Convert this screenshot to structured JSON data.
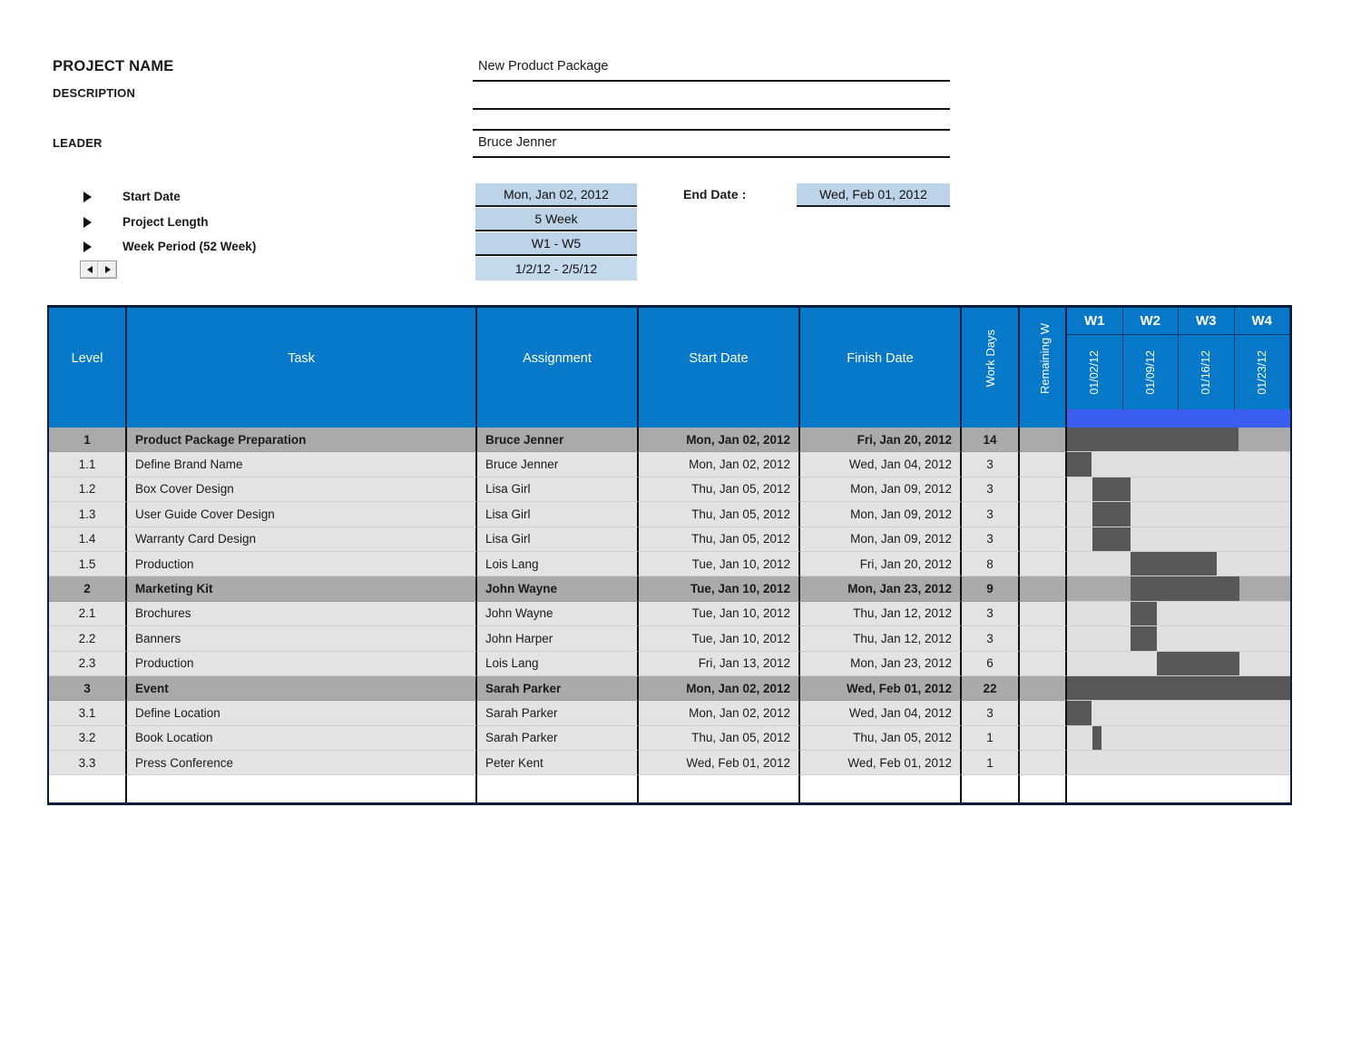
{
  "header": {
    "project_name_label": "PROJECT NAME",
    "description_label": "DESCRIPTION",
    "leader_label": "LEADER",
    "project_name_value": "New Product Package",
    "description_value": "",
    "leader_value": "Bruce Jenner",
    "start_date_label": "Start Date",
    "project_length_label": "Project Length",
    "week_period_label": "Week Period (52 Week)",
    "start_date_value": "Mon, Jan 02, 2012",
    "project_length_value": "5 Week",
    "week_period_value": "W1 - W5",
    "date_range_value": "1/2/12 - 2/5/12",
    "end_date_label": "End Date :",
    "end_date_value": "Wed, Feb 01, 2012",
    "scroll_left": "◀",
    "scroll_right": "▶"
  },
  "colors": {
    "header_blue": "#0878c8",
    "accent_blue": "#3a5ff0",
    "bar_dark": "#585858",
    "group_gray": "#aaaaaa",
    "row_gray": "#e3e3e3",
    "input_blue": "#bcd3e8"
  },
  "table": {
    "columns": [
      {
        "key": "level",
        "label": "Level"
      },
      {
        "key": "task",
        "label": "Task"
      },
      {
        "key": "assg",
        "label": "Assignment"
      },
      {
        "key": "start",
        "label": "Start Date"
      },
      {
        "key": "finish",
        "label": "Finish Date"
      },
      {
        "key": "wd",
        "label": "Work Days"
      },
      {
        "key": "rw",
        "label": "Remaining W"
      }
    ],
    "weeks": [
      {
        "label": "W1",
        "date": "01/02/12"
      },
      {
        "label": "W2",
        "date": "01/09/12"
      },
      {
        "label": "W3",
        "date": "01/16/12"
      },
      {
        "label": "W4",
        "date": "01/23/12"
      }
    ],
    "rows": [
      {
        "level": "1",
        "task": "Product Package Preparation",
        "assignment": "Bruce Jenner",
        "start": "Mon, Jan 02, 2012",
        "finish": "Fri, Jan 20, 2012",
        "work_days": "14",
        "remaining_weeks": "",
        "group": true,
        "bar_left_pct": 0.0,
        "bar_width_pct": 77.0
      },
      {
        "level": "1.1",
        "task": "Define Brand Name",
        "assignment": "Bruce Jenner",
        "start": "Mon, Jan 02, 2012",
        "finish": "Wed, Jan 04, 2012",
        "work_days": "3",
        "remaining_weeks": "",
        "group": false,
        "bar_left_pct": 0.0,
        "bar_width_pct": 11.0
      },
      {
        "level": "1.2",
        "task": "Box Cover Design",
        "assignment": "Lisa Girl",
        "start": "Thu, Jan 05, 2012",
        "finish": "Mon, Jan 09, 2012",
        "work_days": "3",
        "remaining_weeks": "",
        "group": false,
        "bar_left_pct": 11.4,
        "bar_width_pct": 17.0
      },
      {
        "level": "1.3",
        "task": "User Guide Cover Design",
        "assignment": "Lisa Girl",
        "start": "Thu, Jan 05, 2012",
        "finish": "Mon, Jan 09, 2012",
        "work_days": "3",
        "remaining_weeks": "",
        "group": false,
        "bar_left_pct": 11.4,
        "bar_width_pct": 17.0
      },
      {
        "level": "1.4",
        "task": "Warranty Card Design",
        "assignment": "Lisa Girl",
        "start": "Thu, Jan 05, 2012",
        "finish": "Mon, Jan 09, 2012",
        "work_days": "3",
        "remaining_weeks": "",
        "group": false,
        "bar_left_pct": 11.4,
        "bar_width_pct": 17.0
      },
      {
        "level": "1.5",
        "task": "Production",
        "assignment": "Lois Lang",
        "start": "Tue, Jan 10, 2012",
        "finish": "Fri, Jan 20, 2012",
        "work_days": "8",
        "remaining_weeks": "",
        "group": false,
        "bar_left_pct": 28.6,
        "bar_width_pct": 38.5
      },
      {
        "level": "2",
        "task": "Marketing Kit",
        "assignment": "John Wayne",
        "start": "Tue, Jan 10, 2012",
        "finish": "Mon, Jan 23, 2012",
        "work_days": "9",
        "remaining_weeks": "",
        "group": true,
        "bar_left_pct": 28.6,
        "bar_width_pct": 48.5
      },
      {
        "level": "2.1",
        "task": "Brochures",
        "assignment": "John Wayne",
        "start": "Tue, Jan 10, 2012",
        "finish": "Thu, Jan 12, 2012",
        "work_days": "3",
        "remaining_weeks": "",
        "group": false,
        "bar_left_pct": 28.6,
        "bar_width_pct": 11.5
      },
      {
        "level": "2.2",
        "task": "Banners",
        "assignment": "John Harper",
        "start": "Tue, Jan 10, 2012",
        "finish": "Thu, Jan 12, 2012",
        "work_days": "3",
        "remaining_weeks": "",
        "group": false,
        "bar_left_pct": 28.6,
        "bar_width_pct": 11.5
      },
      {
        "level": "2.3",
        "task": "Production",
        "assignment": "Lois Lang",
        "start": "Fri, Jan 13, 2012",
        "finish": "Mon, Jan 23, 2012",
        "work_days": "6",
        "remaining_weeks": "",
        "group": false,
        "bar_left_pct": 40.2,
        "bar_width_pct": 37.0
      },
      {
        "level": "3",
        "task": "Event",
        "assignment": "Sarah Parker",
        "start": "Mon, Jan 02, 2012",
        "finish": "Wed, Feb 01, 2012",
        "work_days": "22",
        "remaining_weeks": "",
        "group": true,
        "bar_left_pct": 0.0,
        "bar_width_pct": 100.0
      },
      {
        "level": "3.1",
        "task": "Define Location",
        "assignment": "Sarah Parker",
        "start": "Mon, Jan 02, 2012",
        "finish": "Wed, Jan 04, 2012",
        "work_days": "3",
        "remaining_weeks": "",
        "group": false,
        "bar_left_pct": 0.0,
        "bar_width_pct": 11.0
      },
      {
        "level": "3.2",
        "task": "Book Location",
        "assignment": "Sarah Parker",
        "start": "Thu, Jan 05, 2012",
        "finish": "Thu, Jan 05, 2012",
        "work_days": "1",
        "remaining_weeks": "",
        "group": false,
        "bar_left_pct": 11.4,
        "bar_width_pct": 4.0
      },
      {
        "level": "3.3",
        "task": "Press Conference",
        "assignment": "Peter Kent",
        "start": "Wed, Feb 01, 2012",
        "finish": "Wed, Feb 01, 2012",
        "work_days": "1",
        "remaining_weeks": "",
        "group": false,
        "bar_left_pct": 0.0,
        "bar_width_pct": 0.0
      }
    ]
  },
  "chart_data": {
    "type": "bar",
    "title": "New Product Package — Gantt Schedule",
    "xlabel": "Week",
    "ylabel": "Task",
    "categories": [
      "Product Package Preparation",
      "Define Brand Name",
      "Box Cover Design",
      "User Guide Cover Design",
      "Warranty Card Design",
      "Production",
      "Marketing Kit",
      "Brochures",
      "Banners",
      "Production",
      "Event",
      "Define Location",
      "Book Location",
      "Press Conference"
    ],
    "values": [
      14,
      3,
      3,
      3,
      3,
      8,
      9,
      3,
      3,
      6,
      22,
      3,
      1,
      1
    ],
    "series": [
      {
        "name": "Work Days",
        "values": [
          14,
          3,
          3,
          3,
          3,
          8,
          9,
          3,
          3,
          6,
          22,
          3,
          1,
          1
        ]
      }
    ],
    "x_tick_labels": [
      "01/02/12",
      "01/09/12",
      "01/16/12",
      "01/23/12"
    ],
    "legend_position": "none",
    "grid": true
  }
}
